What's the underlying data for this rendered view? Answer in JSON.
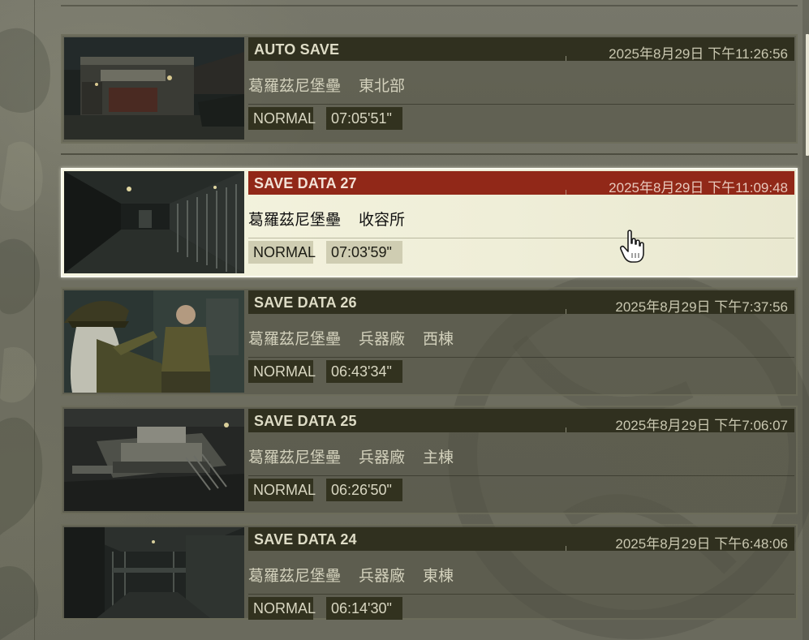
{
  "save_list": {
    "slots": [
      {
        "title": "AUTO SAVE",
        "date": "2025年8月29日 下午11:26:56",
        "location": [
          "葛羅茲尼堡壘",
          "東北部"
        ],
        "difficulty": "NORMAL",
        "play_time": "07:05'51\"",
        "thumbnail_icon": "warehouse-night-thumbnail",
        "selected": false
      },
      {
        "title": "SAVE DATA 27",
        "date": "2025年8月29日 下午11:09:48",
        "location": [
          "葛羅茲尼堡壘",
          "收容所"
        ],
        "difficulty": "NORMAL",
        "play_time": "07:03'59\"",
        "thumbnail_icon": "prison-corridor-thumbnail",
        "selected": true
      },
      {
        "title": "SAVE DATA 26",
        "date": "2025年8月29日 下午7:37:56",
        "location": [
          "葛羅茲尼堡壘",
          "兵器廠",
          "西棟"
        ],
        "difficulty": "NORMAL",
        "play_time": "06:43'34\"",
        "thumbnail_icon": "officer-salute-thumbnail",
        "selected": false
      },
      {
        "title": "SAVE DATA 25",
        "date": "2025年8月29日 下午7:06:07",
        "location": [
          "葛羅茲尼堡壘",
          "兵器廠",
          "主棟"
        ],
        "difficulty": "NORMAL",
        "play_time": "06:26'50\"",
        "thumbnail_icon": "tank-hangar-thumbnail",
        "selected": false
      },
      {
        "title": "SAVE DATA 24",
        "date": "2025年8月29日 下午6:48:06",
        "location": [
          "葛羅茲尼堡壘",
          "兵器廠",
          "東棟"
        ],
        "difficulty": "NORMAL",
        "play_time": "06:14'30\"",
        "thumbnail_icon": "factory-interior-thumbnail",
        "selected": false
      }
    ]
  },
  "colors": {
    "selected_header": "#912818",
    "header": "#30301f",
    "selected_background": "#f5f4df",
    "background": "#6e6e60"
  },
  "cursor_icon": "hand-pointer-icon"
}
